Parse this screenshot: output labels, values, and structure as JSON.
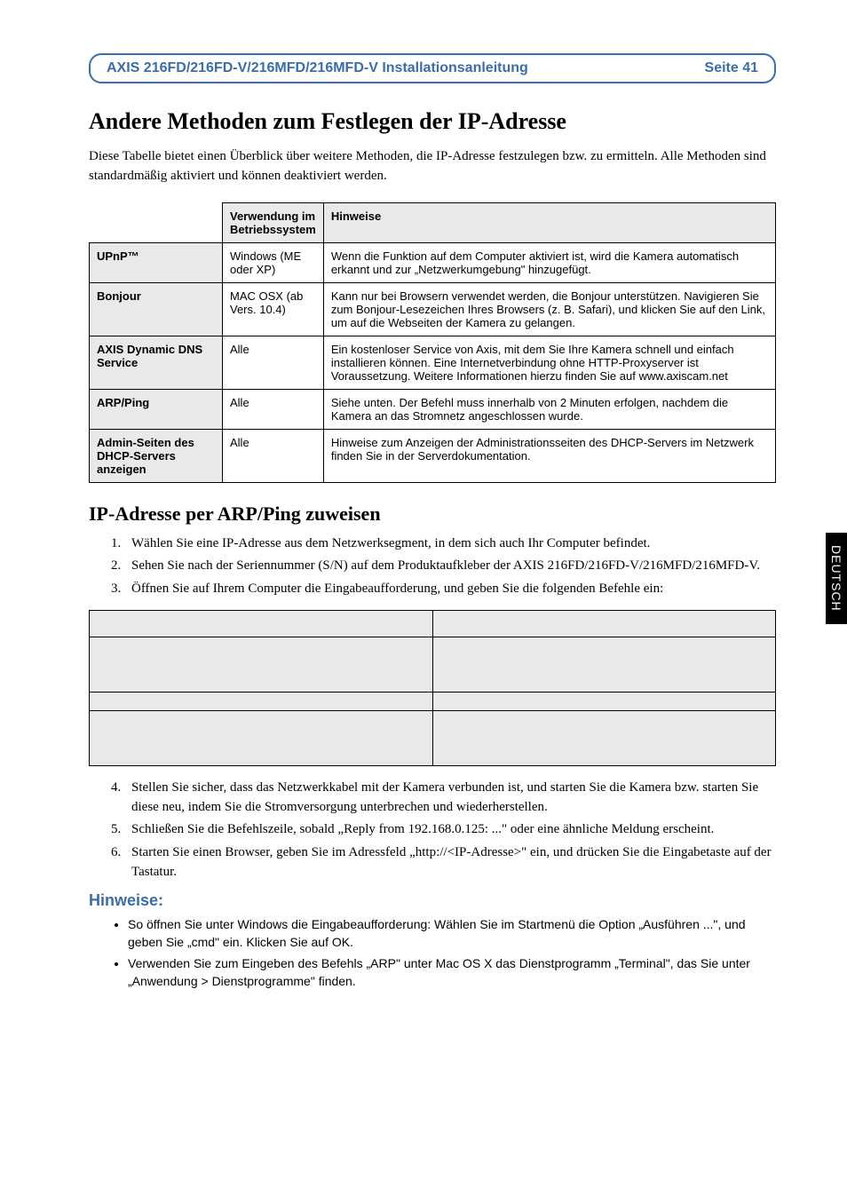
{
  "header": {
    "title": "AXIS 216FD/216FD-V/216MFD/216MFD-V Installationsanleitung",
    "page": "Seite 41"
  },
  "h1": "Andere Methoden zum Festlegen der IP-Adresse",
  "intro": "Diese Tabelle bietet einen Überblick über weitere Methoden, die IP-Adresse festzulegen bzw. zu ermitteln. Alle Methoden sind standardmäßig aktiviert und können deaktiviert werden.",
  "table1": {
    "head_os": "Verwendung im Betriebssystem",
    "head_notes": "Hinweise",
    "rows": [
      {
        "name": "UPnP™",
        "os": "Windows (ME oder XP)",
        "note": "Wenn die Funktion auf dem Computer aktiviert ist, wird die Kamera automatisch erkannt und zur „Netzwerkumgebung\" hinzugefügt."
      },
      {
        "name": "Bonjour",
        "os": "MAC OSX (ab Vers. 10.4)",
        "note": "Kann nur bei Browsern verwendet werden, die Bonjour unterstützen. Navigieren Sie zum Bonjour-Lesezeichen Ihres Browsers (z. B. Safari), und klicken Sie auf den Link, um auf die Webseiten der Kamera zu gelangen."
      },
      {
        "name": "AXIS Dynamic DNS Service",
        "os": "Alle",
        "note": "Ein kostenloser Service von Axis, mit dem Sie Ihre Kamera schnell und einfach installieren können. Eine Internetverbindung ohne HTTP-Proxyserver ist Voraussetzung. Weitere Informationen hierzu finden Sie auf www.axiscam.net"
      },
      {
        "name": "ARP/Ping",
        "os": "Alle",
        "note": "Siehe unten. Der Befehl muss innerhalb von 2 Minuten erfolgen, nachdem die Kamera an das Stromnetz angeschlossen wurde."
      },
      {
        "name": "Admin-Seiten des DHCP-Servers anzeigen",
        "os": "Alle",
        "note": "Hinweise zum Anzeigen der Administrationsseiten des DHCP-Servers im Netzwerk finden Sie in der Serverdokumentation."
      }
    ]
  },
  "h2": "IP-Adresse per ARP/Ping zuweisen",
  "steps_a": [
    "Wählen Sie eine IP-Adresse aus dem Netzwerksegment, in dem sich auch Ihr Computer befindet.",
    "Sehen Sie nach der Seriennummer (S/N) auf dem Produktaufkleber der AXIS 216FD/216FD-V/216MFD/216MFD-V.",
    "Öffnen Sie auf Ihrem Computer die Eingabeaufforderung, und geben Sie die folgenden Befehle ein:"
  ],
  "steps_b": [
    "Stellen Sie sicher, dass das Netzwerkkabel mit der Kamera verbunden ist, und starten Sie die Kamera bzw. starten Sie diese neu, indem Sie die Stromversorgung unterbrechen und wiederherstellen.",
    "Schließen Sie die Befehlszeile, sobald „Reply from 192.168.0.125: ...\" oder eine ähnliche Meldung erscheint.",
    "Starten Sie einen Browser, geben Sie im Adressfeld „http://<IP-Adresse>\" ein, und drücken Sie die Eingabetaste auf der Tastatur."
  ],
  "notes_heading": "Hinweise:",
  "notes": [
    "So öffnen Sie unter Windows die Eingabeaufforderung: Wählen Sie im Startmenü die Option „Ausführen ...\", und geben Sie „cmd\" ein.  Klicken Sie auf OK.",
    "Verwenden Sie zum Eingeben des Befehls „ARP\" unter Mac OS X das Dienstprogramm „Terminal\", das Sie unter „Anwendung > Dienstprogramme\" finden."
  ],
  "side_tab": "DEUTSCH"
}
